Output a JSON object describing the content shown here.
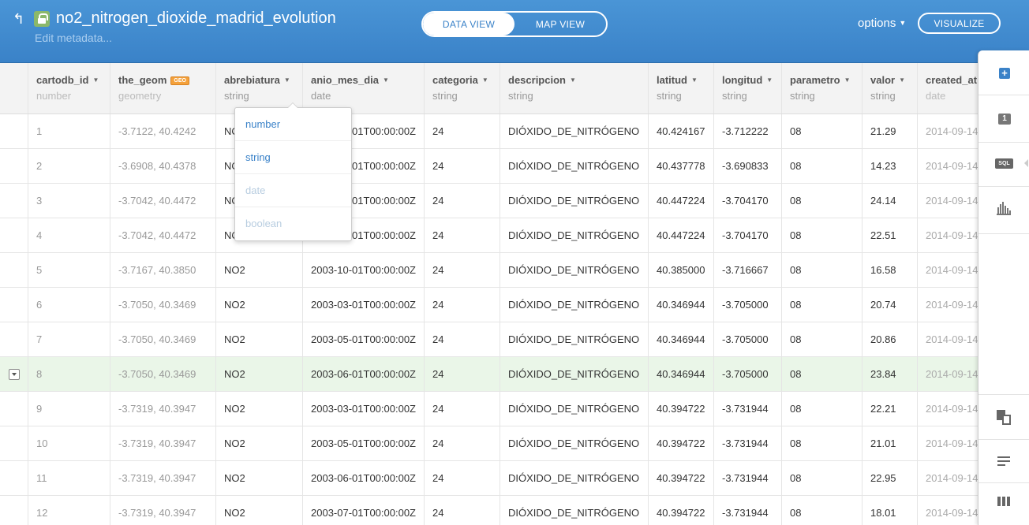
{
  "header": {
    "title": "no2_nitrogen_dioxide_madrid_evolution",
    "edit_metadata": "Edit metadata...",
    "data_view_label": "DATA VIEW",
    "map_view_label": "MAP VIEW",
    "options_label": "options",
    "visualize_label": "VISUALIZE",
    "brand_color": "#3a82c8"
  },
  "columns": [
    {
      "name": "",
      "type": ""
    },
    {
      "name": "cartodb_id",
      "type": "number"
    },
    {
      "name": "the_geom",
      "type": "geometry",
      "badge": "GEO"
    },
    {
      "name": "abrebiatura",
      "type": "string"
    },
    {
      "name": "anio_mes_dia",
      "type": "date"
    },
    {
      "name": "categoria",
      "type": "string"
    },
    {
      "name": "descripcion",
      "type": "string"
    },
    {
      "name": "latitud",
      "type": "string"
    },
    {
      "name": "longitud",
      "type": "string"
    },
    {
      "name": "parametro",
      "type": "string"
    },
    {
      "name": "valor",
      "type": "string"
    },
    {
      "name": "created_at",
      "type": "date"
    }
  ],
  "rows": [
    [
      "1",
      "-3.7122, 40.4242",
      "NO2",
      "2003-01-01T00:00:00Z",
      "24",
      "DIÓXIDO_DE_NITRÓGENO",
      "40.424167",
      "-3.712222",
      "08",
      "21.29",
      "2014-09-14"
    ],
    [
      "2",
      "-3.6908, 40.4378",
      "NO2",
      "2003-01-01T00:00:00Z",
      "24",
      "DIÓXIDO_DE_NITRÓGENO",
      "40.437778",
      "-3.690833",
      "08",
      "14.23",
      "2014-09-14"
    ],
    [
      "3",
      "-3.7042, 40.4472",
      "NO2",
      "2003-01-01T00:00:00Z",
      "24",
      "DIÓXIDO_DE_NITRÓGENO",
      "40.447224",
      "-3.704170",
      "08",
      "24.14",
      "2014-09-14"
    ],
    [
      "4",
      "-3.7042, 40.4472",
      "NO2",
      "2003-01-01T00:00:00Z",
      "24",
      "DIÓXIDO_DE_NITRÓGENO",
      "40.447224",
      "-3.704170",
      "08",
      "22.51",
      "2014-09-14"
    ],
    [
      "5",
      "-3.7167, 40.3850",
      "NO2",
      "2003-10-01T00:00:00Z",
      "24",
      "DIÓXIDO_DE_NITRÓGENO",
      "40.385000",
      "-3.716667",
      "08",
      "16.58",
      "2014-09-14"
    ],
    [
      "6",
      "-3.7050, 40.3469",
      "NO2",
      "2003-03-01T00:00:00Z",
      "24",
      "DIÓXIDO_DE_NITRÓGENO",
      "40.346944",
      "-3.705000",
      "08",
      "20.74",
      "2014-09-14"
    ],
    [
      "7",
      "-3.7050, 40.3469",
      "NO2",
      "2003-05-01T00:00:00Z",
      "24",
      "DIÓXIDO_DE_NITRÓGENO",
      "40.346944",
      "-3.705000",
      "08",
      "20.86",
      "2014-09-14"
    ],
    [
      "8",
      "-3.7050, 40.3469",
      "NO2",
      "2003-06-01T00:00:00Z",
      "24",
      "DIÓXIDO_DE_NITRÓGENO",
      "40.346944",
      "-3.705000",
      "08",
      "23.84",
      "2014-09-14"
    ],
    [
      "9",
      "-3.7319, 40.3947",
      "NO2",
      "2003-03-01T00:00:00Z",
      "24",
      "DIÓXIDO_DE_NITRÓGENO",
      "40.394722",
      "-3.731944",
      "08",
      "22.21",
      "2014-09-14"
    ],
    [
      "10",
      "-3.7319, 40.3947",
      "NO2",
      "2003-05-01T00:00:00Z",
      "24",
      "DIÓXIDO_DE_NITRÓGENO",
      "40.394722",
      "-3.731944",
      "08",
      "21.01",
      "2014-09-14"
    ],
    [
      "11",
      "-3.7319, 40.3947",
      "NO2",
      "2003-06-01T00:00:00Z",
      "24",
      "DIÓXIDO_DE_NITRÓGENO",
      "40.394722",
      "-3.731944",
      "08",
      "22.95",
      "2014-09-14"
    ],
    [
      "12",
      "-3.7319, 40.3947",
      "NO2",
      "2003-07-01T00:00:00Z",
      "24",
      "DIÓXIDO_DE_NITRÓGENO",
      "40.394722",
      "-3.731944",
      "08",
      "18.01",
      "2014-09-14"
    ]
  ],
  "selected_row": "8",
  "type_dropdown": {
    "options": [
      {
        "label": "number",
        "state": "enabled"
      },
      {
        "label": "string",
        "state": "enabled"
      },
      {
        "label": "date",
        "state": "disabled"
      },
      {
        "label": "boolean",
        "state": "disabled"
      }
    ]
  },
  "sidebar": {
    "layer_number": "1",
    "sql_label": "SQL",
    "items": [
      "add-layer-icon",
      "layer-icon",
      "sql-icon",
      "filter-icon",
      "merge-tables-icon",
      "add-row-icon",
      "add-column-icon"
    ]
  }
}
